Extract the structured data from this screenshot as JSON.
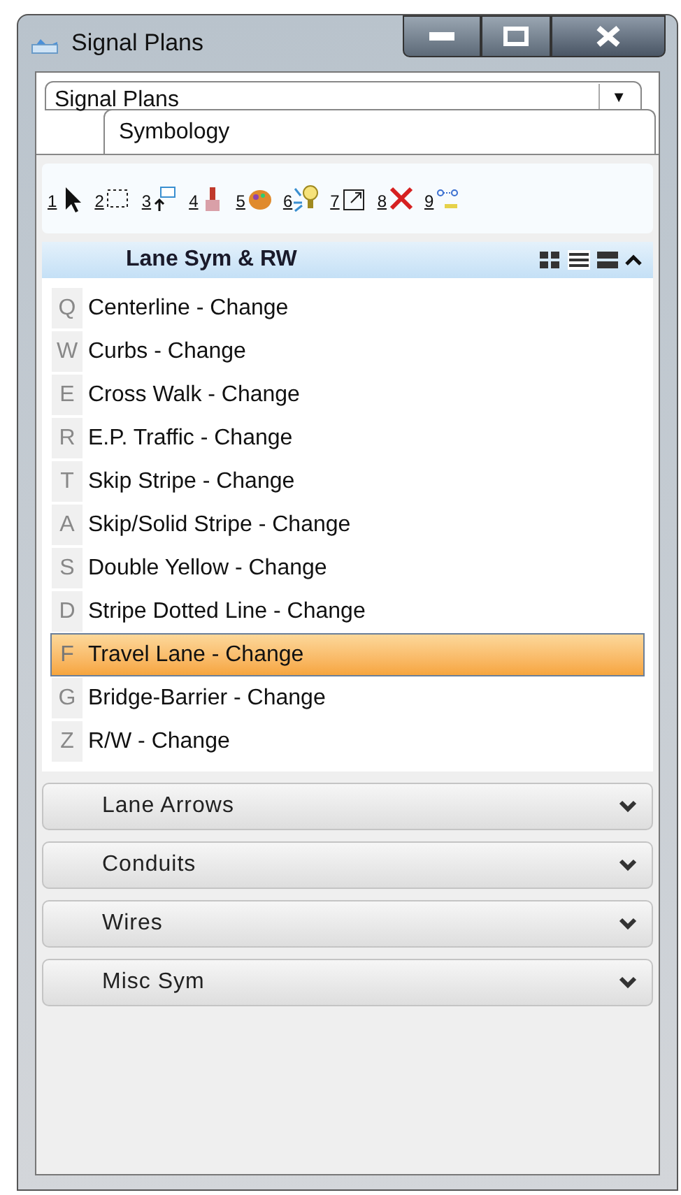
{
  "window": {
    "title": "Signal Plans"
  },
  "task_dropdown": {
    "value": "Signal Plans",
    "caret": "▼"
  },
  "tab": {
    "label": "Symbology"
  },
  "tools": [
    {
      "number": "1"
    },
    {
      "number": "2"
    },
    {
      "number": "3"
    },
    {
      "number": "4"
    },
    {
      "number": "5"
    },
    {
      "number": "6"
    },
    {
      "number": "7"
    },
    {
      "number": "8"
    },
    {
      "number": "9"
    }
  ],
  "sections": [
    {
      "title": "Lane Sym & RW",
      "expanded": true,
      "items": [
        {
          "key": "Q",
          "label": "Centerline - Change",
          "selected": false
        },
        {
          "key": "W",
          "label": "Curbs - Change",
          "selected": false
        },
        {
          "key": "E",
          "label": "Cross Walk - Change",
          "selected": false
        },
        {
          "key": "R",
          "label": "E.P. Traffic - Change",
          "selected": false
        },
        {
          "key": "T",
          "label": "Skip Stripe - Change",
          "selected": false
        },
        {
          "key": "A",
          "label": "Skip/Solid Stripe - Change",
          "selected": false
        },
        {
          "key": "S",
          "label": "Double Yellow - Change",
          "selected": false
        },
        {
          "key": "D",
          "label": "Stripe Dotted Line - Change",
          "selected": false
        },
        {
          "key": "F",
          "label": "Travel Lane - Change",
          "selected": true
        },
        {
          "key": "G",
          "label": "Bridge-Barrier - Change",
          "selected": false
        },
        {
          "key": "Z",
          "label": "R/W - Change",
          "selected": false
        }
      ]
    },
    {
      "title": "Lane Arrows",
      "expanded": false
    },
    {
      "title": "Conduits",
      "expanded": false
    },
    {
      "title": "Wires",
      "expanded": false
    },
    {
      "title": "Misc Sym",
      "expanded": false
    }
  ]
}
